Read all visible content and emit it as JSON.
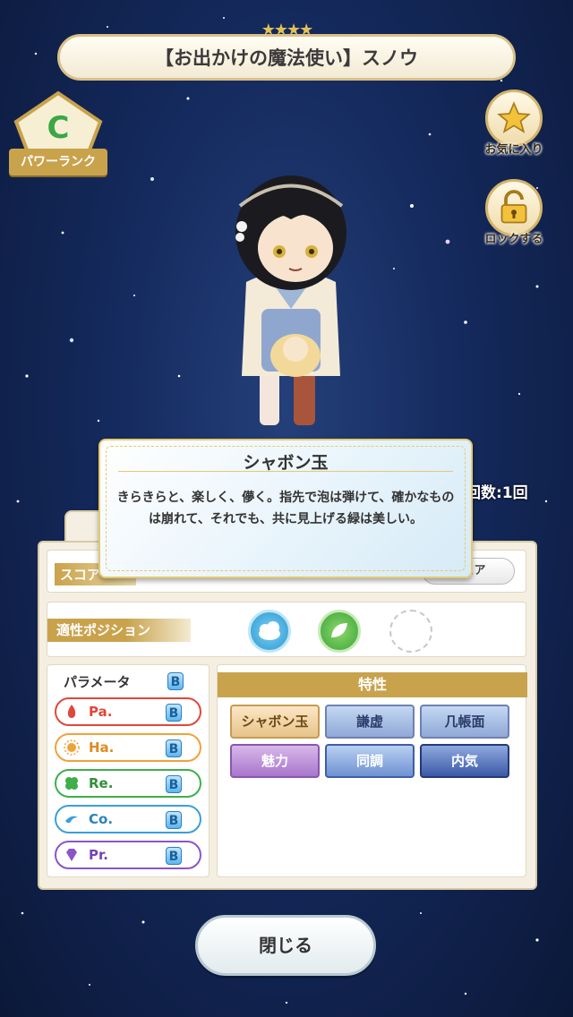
{
  "title": {
    "stars": "★★★★",
    "name": "【お出かけの魔法使い】スノウ"
  },
  "power_rank": {
    "grade": "C",
    "label": "パワーランク"
  },
  "side_buttons": {
    "favorite": "お気に入り",
    "lock": "ロックする"
  },
  "count": "回数:1回",
  "score": {
    "label": "スコア",
    "button": "スコア"
  },
  "position": {
    "label": "適性ポジション"
  },
  "params": {
    "title": "パラメータ",
    "grade": "B",
    "items": [
      {
        "name": "Pa.",
        "grade": "B",
        "color": "#e0473a"
      },
      {
        "name": "Ha.",
        "grade": "B",
        "color": "#f0a23a"
      },
      {
        "name": "Re.",
        "grade": "B",
        "color": "#3fae4a"
      },
      {
        "name": "Co.",
        "grade": "B",
        "color": "#3a9fd9"
      },
      {
        "name": "Pr.",
        "grade": "B",
        "color": "#8a55c9"
      }
    ]
  },
  "traits": {
    "title": "特性",
    "items": [
      "シャボン玉",
      "謙虚",
      "几帳面",
      "魅力",
      "同調",
      "内気"
    ]
  },
  "popup": {
    "title": "シャボン玉",
    "text": "きらきらと、楽しく、儚く。指先で泡は弾けて、確かなものは崩れて、それでも、共に見上げる緑は美しい。"
  },
  "close_button": "閉じる"
}
